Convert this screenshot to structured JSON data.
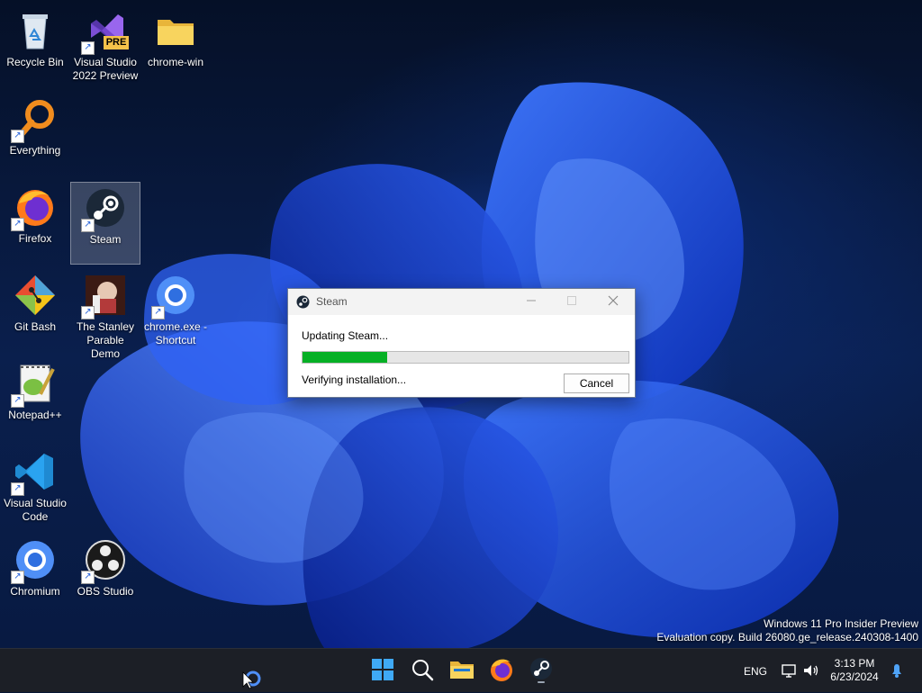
{
  "desktop": {
    "icons": [
      {
        "label": "Recycle Bin"
      },
      {
        "label": "Visual Studio 2022 Preview",
        "badge": "PRE"
      },
      {
        "label": "chrome-win"
      },
      {
        "label": "Everything"
      },
      {
        "label": "Firefox"
      },
      {
        "label": "Steam"
      },
      {
        "label": "Git Bash"
      },
      {
        "label": "The Stanley Parable Demo"
      },
      {
        "label": "chrome.exe - Shortcut"
      },
      {
        "label": "Notepad++"
      },
      {
        "label": "Visual Studio Code"
      },
      {
        "label": "Chromium"
      },
      {
        "label": "OBS Studio"
      }
    ],
    "watermark": {
      "line1": "Windows 11 Pro Insider Preview",
      "line2": "Evaluation copy. Build 26080.ge_release.240308-1400"
    }
  },
  "dialog": {
    "title": "Steam",
    "label": "Updating Steam...",
    "progress_fraction": 0.26,
    "status": "Verifying installation...",
    "cancel_label": "Cancel"
  },
  "taskbar": {
    "apps": [
      "start-icon",
      "search-icon",
      "file-explorer-icon",
      "firefox-icon",
      "steam-icon"
    ],
    "tray": {
      "language": "ENG",
      "time": "3:13 PM",
      "date": "6/23/2024"
    }
  },
  "colors": {
    "progress": "#06b025",
    "taskbar": "#1c1f26",
    "accent": "#1d5bd8"
  }
}
